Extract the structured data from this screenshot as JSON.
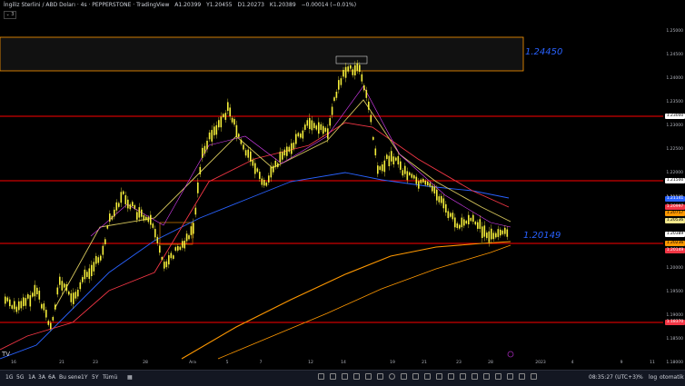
{
  "header": {
    "title": "İngiliz Sterlini / ABD Doları · 4s · PEPPERSTONE · TradingView",
    "open": "A1.20399",
    "high": "Y1.20455",
    "low": "D1.20273",
    "close": "K1.20389",
    "change": "−0.00014 (−0.01%)",
    "collapse": "⌄ 3"
  },
  "price_axis": {
    "ticks": [
      "1.25000",
      "1.24500",
      "1.24000",
      "1.23500",
      "1.23000",
      "1.22500",
      "1.22000",
      "1.21500",
      "1.21000",
      "1.20500",
      "1.20000",
      "1.19500",
      "1.19000",
      "1.18500",
      "1.18000"
    ],
    "tags": [
      {
        "label": "1.23000",
        "bg": "#ffffff",
        "fg": "#000000"
      },
      {
        "label": "1.21500",
        "bg": "#ffffff",
        "fg": "#000000"
      },
      {
        "label": "1.21141",
        "bg": "#2962ff",
        "fg": "#ffffff"
      },
      {
        "label": "1.20997",
        "bg": "#f23645",
        "fg": "#ffffff"
      },
      {
        "label": "1.20757",
        "bg": "#ff9800",
        "fg": "#000000"
      },
      {
        "label": "1.20536",
        "bg": "#f0e68c",
        "fg": "#000000"
      },
      {
        "label": "1.20389",
        "bg": "#ffffff",
        "fg": "#000000"
      },
      {
        "label": "1.20236",
        "bg": "#ff9800",
        "fg": "#000000"
      },
      {
        "label": "1.20149",
        "bg": "#f23645",
        "fg": "#ffffff"
      },
      {
        "label": "1.18370",
        "bg": "#f23645",
        "fg": "#ffffff"
      }
    ]
  },
  "time_axis": {
    "ticks": [
      "16",
      "21",
      "23",
      "28",
      "Ara",
      "5",
      "7",
      "12",
      "14",
      "19",
      "21",
      "23",
      "28",
      "2023",
      "4",
      "9",
      "11"
    ]
  },
  "annotations": {
    "resistance_label": "1.24450",
    "support_label": "1.20149"
  },
  "bottom_bar": {
    "ranges": [
      "1G",
      "5G",
      "1A",
      "3A",
      "6A",
      "Bu sene",
      "1Y",
      "5Y",
      "Tümü"
    ],
    "time": "08:35:27 (UTC+3)",
    "percent": "%",
    "log": "log",
    "auto": "otomatik"
  },
  "colors": {
    "candle": "#f5ee3a",
    "ma_blue": "#2962ff",
    "ma_red": "#f23645",
    "ma_orange": "#ff9800",
    "ma_khaki": "#d6c65c",
    "ma_pink": "#e040fb",
    "hline": "#ff0000"
  }
}
